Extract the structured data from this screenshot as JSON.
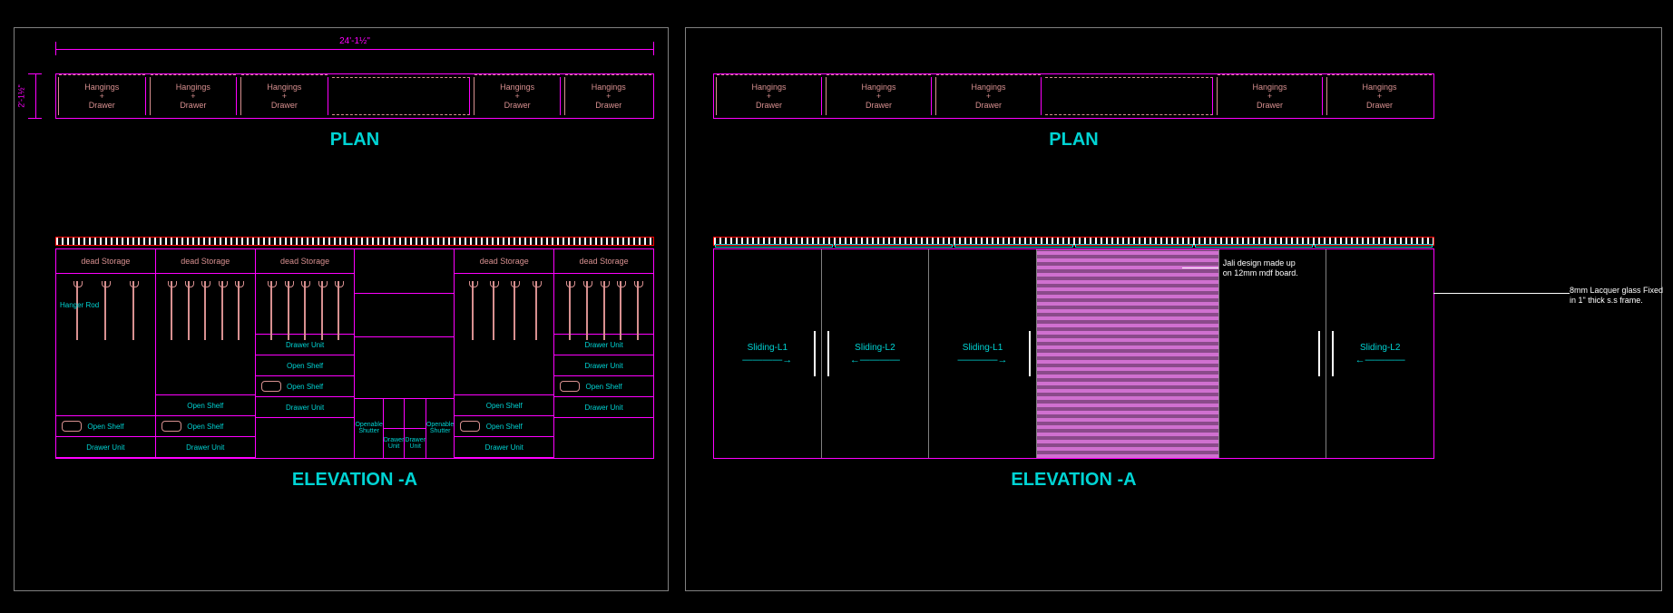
{
  "dimensions": {
    "width": "24'-1½\"",
    "depth": "2'-1½\""
  },
  "titles": {
    "plan": "PLAN",
    "elevation": "ELEVATION -A"
  },
  "plan_cells": {
    "label_line1": "Hangings",
    "label_line2": "+",
    "label_line3": "Drawer"
  },
  "elev_left": {
    "dead": "dead Storage",
    "hanger_rod": "Hanger Rod",
    "open_shelf": "Open Shelf",
    "drawer_unit": "Drawer Unit",
    "openable_shutter": "Openable Shutter",
    "drawer_unit_small": "Drawer Unit"
  },
  "elev_right": {
    "sliding_l1": "Sliding-L1",
    "sliding_l2": "Sliding-L2",
    "arrow_left": "←————",
    "arrow_right": "————→",
    "jali_note": "Jali design made up on 12mm mdf board.",
    "glass_note": "8mm Lacquer glass Fixed in 1\" thick s.s frame."
  }
}
